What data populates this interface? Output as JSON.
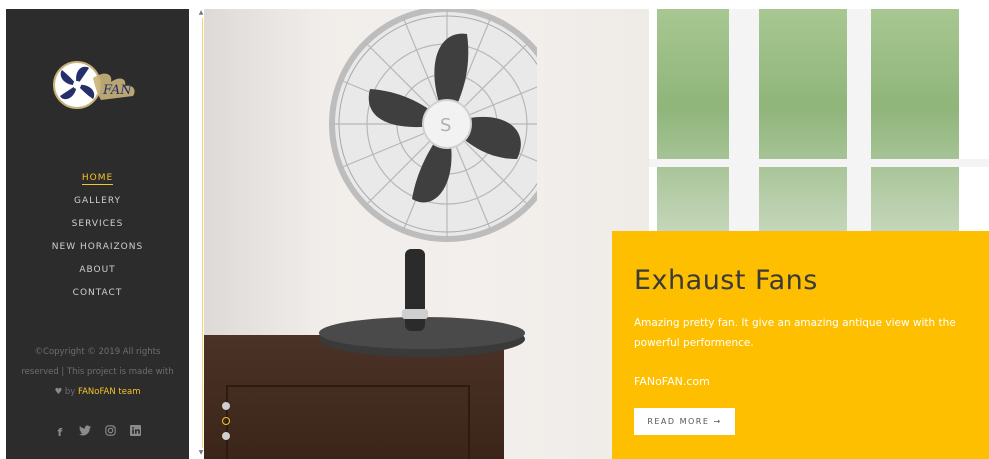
{
  "sidebar": {
    "nav": [
      {
        "label": "HOME",
        "active": true
      },
      {
        "label": "GALLERY"
      },
      {
        "label": "SERVICES"
      },
      {
        "label": "NEW HORAIZONS"
      },
      {
        "label": "ABOUT"
      },
      {
        "label": "CONTACT"
      }
    ],
    "copyright_line1": "©Copyright © 2019 All rights",
    "copyright_line2": "reserved | This project is made with",
    "copyright_by": "by",
    "copyright_team": "FANoFAN team",
    "social_icons": [
      "facebook-icon",
      "twitter-icon",
      "instagram-icon",
      "linkedin-icon"
    ]
  },
  "hero": {
    "title": "Exhaust Fans",
    "description": "Amazing pretty fan. It give an amazing antique view with the powerful performence.",
    "site": "FANoFAN.com",
    "button": "READ MORE →",
    "slides": 3,
    "active_slide": 2
  },
  "colors": {
    "accent": "#fdbf00",
    "sidebar_bg": "#2c2c2c",
    "nav_active": "#f6c32a"
  }
}
